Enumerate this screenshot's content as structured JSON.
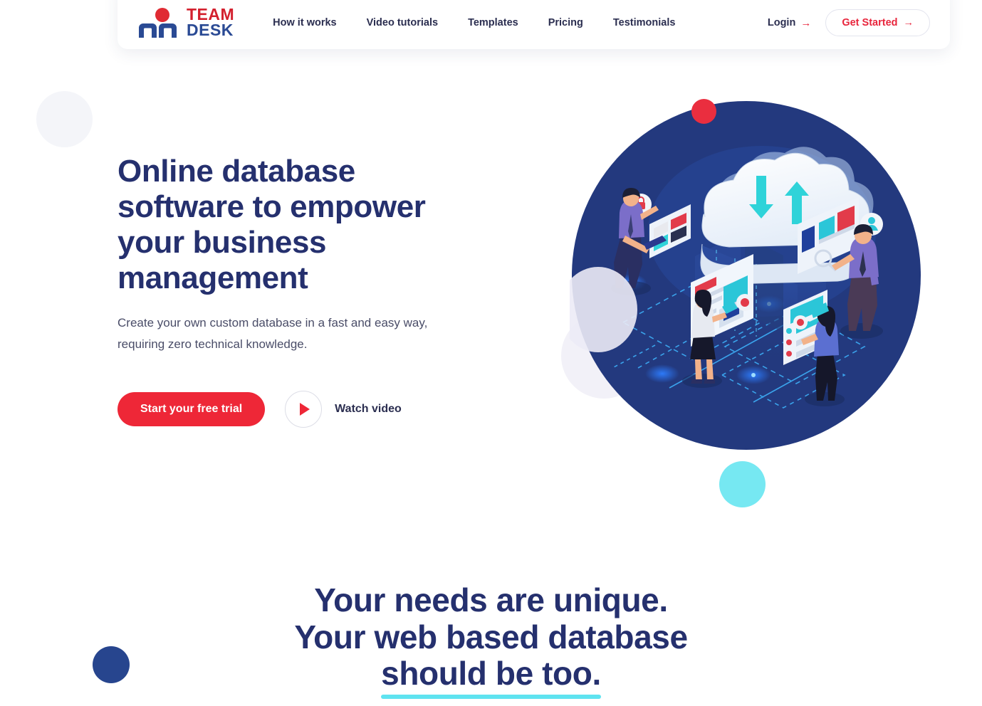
{
  "brand": {
    "logo_line1": "TEAM",
    "logo_line2": "DESK",
    "logo_red": "#d3202e",
    "logo_navy": "#2a4a94"
  },
  "header": {
    "nav": [
      {
        "label": "How it works"
      },
      {
        "label": "Video tutorials"
      },
      {
        "label": "Templates"
      },
      {
        "label": "Pricing"
      },
      {
        "label": "Testimonials"
      }
    ],
    "login_label": "Login",
    "login_arrow": "→",
    "get_started_label": "Get Started",
    "get_started_arrow": "→"
  },
  "hero": {
    "title_line1": "Online database",
    "title_line2": "software to empower",
    "title_line3": "your business",
    "title_line4": "management",
    "subtitle_line1": "Create your own custom database in a fast and easy way,",
    "subtitle_line2": "requiring zero technical knowledge.",
    "cta_primary": "Start your free trial",
    "cta_video": "Watch video",
    "title_color": "#25306e",
    "cta_primary_color": "#ee2737"
  },
  "illustration": {
    "name": "isometric-cloud-database-team",
    "circle_color": "#23397e",
    "accent_dot_color": "#ea2e3f",
    "cloud_color": "#f3f7fd",
    "arrow_color": "#2fd3d9"
  },
  "decor": {
    "pale_circle": "#f4f5f9",
    "cyan_circle": "#76e8f2",
    "navy_circle": "#27458e"
  },
  "section_headline": {
    "line1": "Your needs are unique.",
    "line2": "Your web based database",
    "line3": "should be too.",
    "underline_color": "#5fe3f0"
  }
}
